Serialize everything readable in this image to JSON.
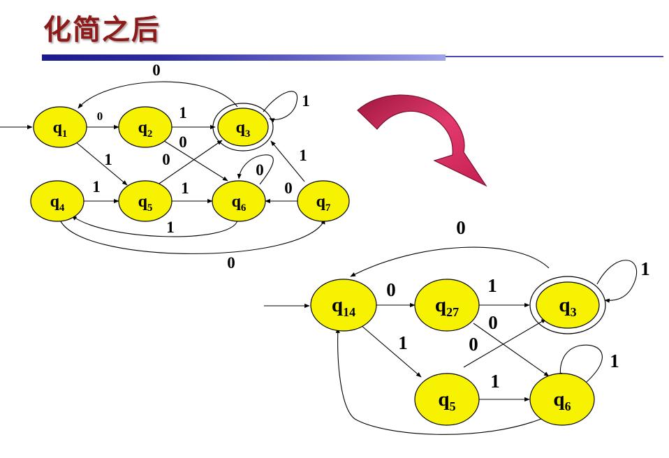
{
  "title": "化简之后",
  "colors": {
    "state_fill": "#f7f300",
    "title": "#8b1a1a",
    "arrow": "#d6235a"
  },
  "original": {
    "states": [
      {
        "base": "q",
        "sub": "1"
      },
      {
        "base": "q",
        "sub": "2"
      },
      {
        "base": "q",
        "sub": "3"
      },
      {
        "base": "q",
        "sub": "4"
      },
      {
        "base": "q",
        "sub": "5"
      },
      {
        "base": "q",
        "sub": "6"
      },
      {
        "base": "q",
        "sub": "7"
      }
    ],
    "edge_labels": [
      "0",
      "0",
      "1",
      "1",
      "1",
      "0",
      "0",
      "1",
      "1",
      "0",
      "0",
      "1",
      "1",
      "0"
    ]
  },
  "minimized": {
    "states": [
      {
        "base": "q",
        "sub": "14"
      },
      {
        "base": "q",
        "sub": "27"
      },
      {
        "base": "q",
        "sub": "3"
      },
      {
        "base": "q",
        "sub": "5"
      },
      {
        "base": "q",
        "sub": "6"
      }
    ],
    "edge_labels": [
      "0",
      "1",
      "1",
      "0",
      "1",
      "0",
      "0",
      "1",
      "1"
    ]
  },
  "transform_arrow_icon": "curved-arrow-icon"
}
